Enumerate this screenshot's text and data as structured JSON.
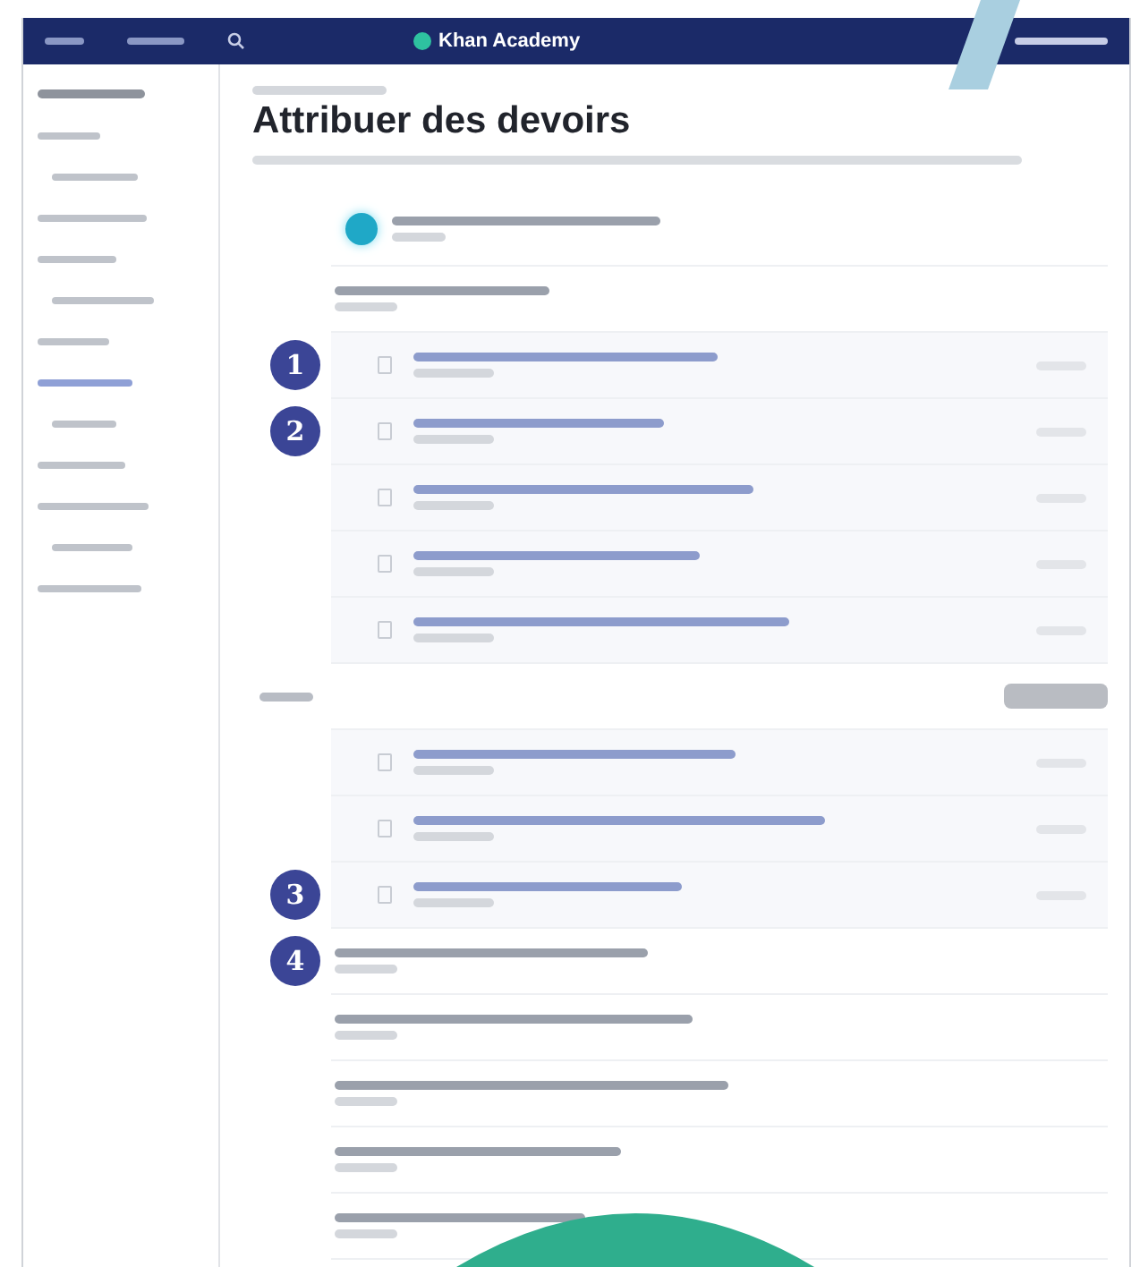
{
  "nav": {
    "brand": "Khan Academy"
  },
  "page": {
    "title": "Attribuer des devoirs"
  },
  "sidebar": {
    "items": [
      {
        "selected": false
      },
      {
        "selected": false
      },
      {
        "selected": false
      },
      {
        "selected": false
      },
      {
        "selected": false
      },
      {
        "selected": false
      },
      {
        "selected": true
      },
      {
        "selected": false
      },
      {
        "selected": false
      },
      {
        "selected": false
      },
      {
        "selected": false
      },
      {
        "selected": false
      }
    ]
  },
  "rows": [
    {
      "kind": "unit"
    },
    {
      "kind": "section"
    },
    {
      "kind": "lesson",
      "marker": "1"
    },
    {
      "kind": "lesson",
      "marker": "2"
    },
    {
      "kind": "lesson"
    },
    {
      "kind": "lesson"
    },
    {
      "kind": "lesson"
    },
    {
      "kind": "header"
    },
    {
      "kind": "lesson"
    },
    {
      "kind": "lesson"
    },
    {
      "kind": "lesson",
      "marker": "3"
    },
    {
      "kind": "section",
      "marker": "4"
    },
    {
      "kind": "section"
    },
    {
      "kind": "section"
    },
    {
      "kind": "section"
    },
    {
      "kind": "section"
    }
  ]
}
